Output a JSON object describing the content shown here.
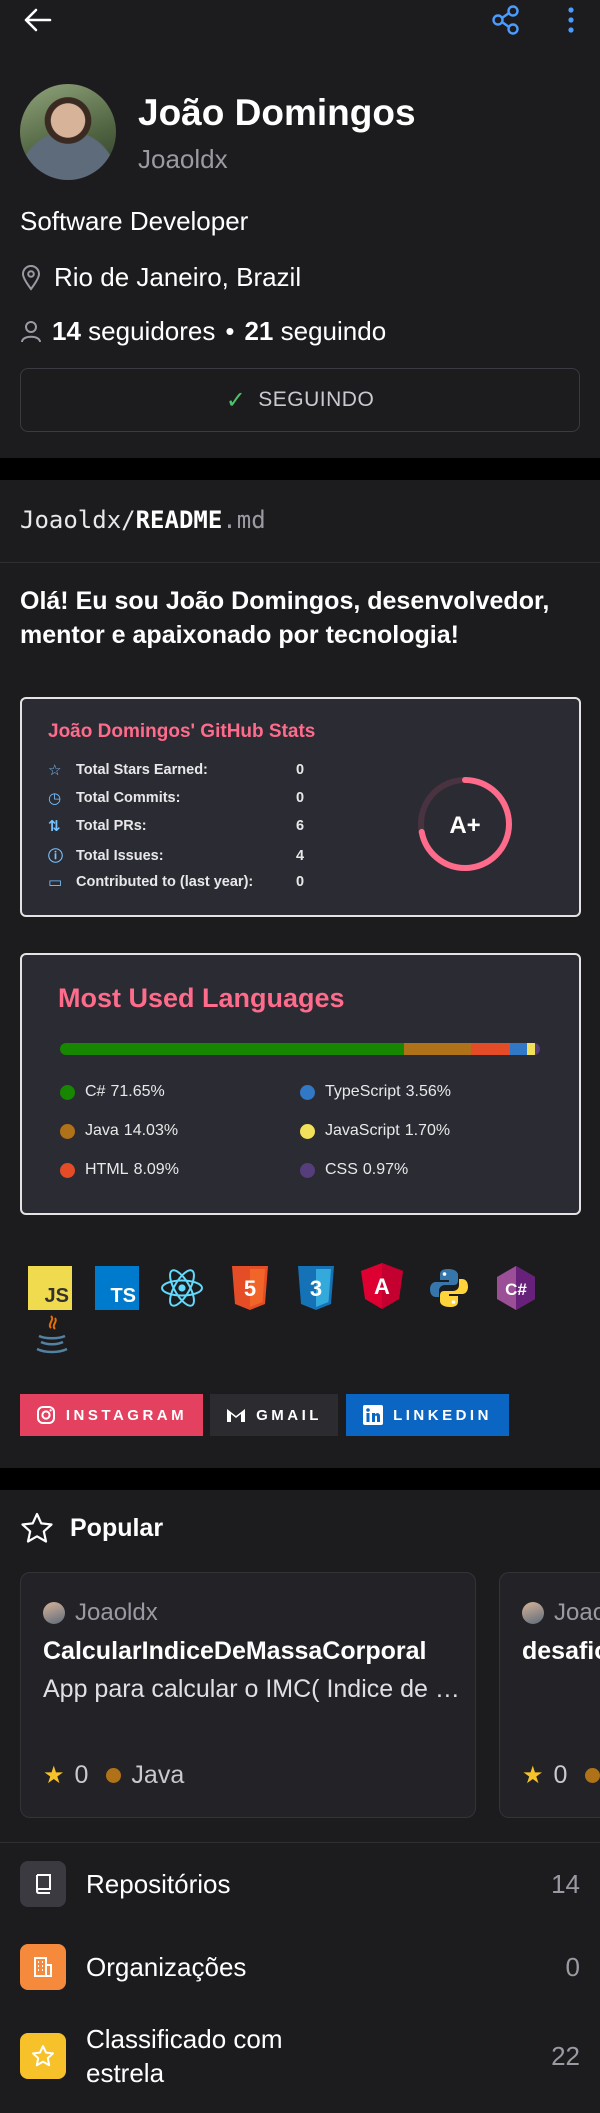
{
  "profile": {
    "name": "João Domingos",
    "login": "Joaoldx",
    "bio": "Software Developer",
    "location": "Rio de Janeiro, Brazil",
    "followers_count": "14",
    "followers_label": "seguidores",
    "separator": "•",
    "following_count": "21",
    "following_label": "seguindo",
    "follow_button": "SEGUINDO"
  },
  "readme": {
    "owner": "Joaoldx/",
    "file": "README",
    "ext": ".md",
    "intro": "Olá! Eu sou João Domingos, desenvolvedor, mentor e apaixonado por tecnologia!"
  },
  "stats": {
    "title": "João Domingos' GitHub Stats",
    "rows": [
      {
        "label": "Total Stars Earned:",
        "value": "0",
        "icon": "star-icon"
      },
      {
        "label": "Total Commits:",
        "value": "0",
        "icon": "history-icon"
      },
      {
        "label": "Total PRs:",
        "value": "6",
        "icon": "pull-request-icon"
      },
      {
        "label": "Total Issues:",
        "value": "4",
        "icon": "issue-icon"
      },
      {
        "label": "Contributed to (last year):",
        "value": "0",
        "icon": "repo-icon"
      }
    ],
    "grade": "A+",
    "grade_fraction": 0.72,
    "accent": "#fe6b8b"
  },
  "languages": {
    "title": "Most Used Languages",
    "items": [
      {
        "name": "C#",
        "percent": "71.65%",
        "value": 71.65,
        "color": "#178600"
      },
      {
        "name": "Java",
        "percent": "14.03%",
        "value": 14.03,
        "color": "#b07219"
      },
      {
        "name": "HTML",
        "percent": "8.09%",
        "value": 8.09,
        "color": "#e34c26"
      },
      {
        "name": "TypeScript",
        "percent": "3.56%",
        "value": 3.56,
        "color": "#3178c6"
      },
      {
        "name": "JavaScript",
        "percent": "1.70%",
        "value": 1.7,
        "color": "#f1e05a"
      },
      {
        "name": "CSS",
        "percent": "0.97%",
        "value": 0.97,
        "color": "#563d7c"
      }
    ]
  },
  "tech_icons": {
    "js": "JS",
    "ts": "TS",
    "html": "5",
    "css": "3",
    "angular": "A",
    "csharp": "C#"
  },
  "socials": {
    "instagram": "INSTAGRAM",
    "gmail": "GMAIL",
    "linkedin": "LINKEDIN"
  },
  "popular": {
    "title": "Popular",
    "repos": [
      {
        "owner": "Joaoldx",
        "name": "CalcularIndiceDeMassaCorporal",
        "description": "App para calcular o IMC( Indice de Massa Corporal)",
        "stars": "0",
        "language": "Java",
        "language_color": "#b07219"
      },
      {
        "owner": "Joaoldx",
        "name": "desafio",
        "description": "",
        "stars": "0",
        "language": "",
        "language_color": "#b07219"
      }
    ]
  },
  "menu": [
    {
      "label": "Repositórios",
      "count": "14",
      "color": "#3a3a40",
      "icon": "repo-icon"
    },
    {
      "label": "Organizações",
      "count": "0",
      "color": "#f58a3c",
      "icon": "organization-icon"
    },
    {
      "label": "Classificado com estrela",
      "count": "22",
      "color": "#f7c12a",
      "icon": "star-icon"
    }
  ]
}
